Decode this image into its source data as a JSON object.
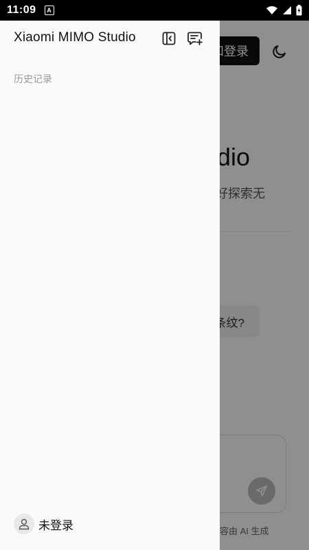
{
  "status_bar": {
    "time": "11:09",
    "app_icon": "A",
    "icons": [
      "wifi-icon",
      "signal-icon",
      "battery-icon"
    ]
  },
  "main": {
    "login_button_label": "和登录",
    "title": "udio",
    "subtitle": "备好探索无",
    "suggestion": "条纹?",
    "disclaimer": "容由 AI 生成"
  },
  "drawer": {
    "logo": "Xiaomi MIMO Studio",
    "history_label": "历史记录",
    "user_label": "未登录"
  },
  "colors": {
    "drawer_bg": "#fafafa",
    "scrim": "rgba(0,0,0,0.44)",
    "login_button_bg": "#111111"
  }
}
